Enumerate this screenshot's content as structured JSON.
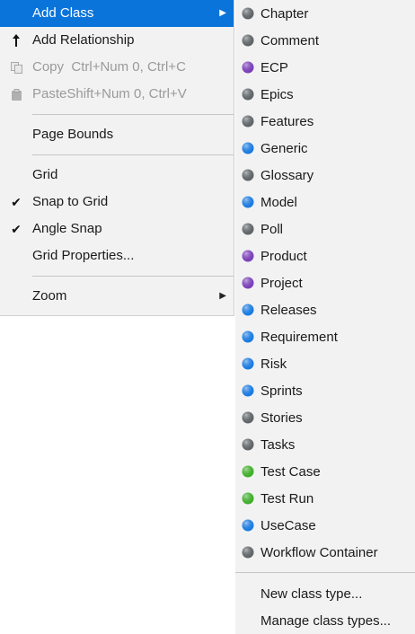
{
  "menu": {
    "items": [
      {
        "label": "Add Class"
      },
      {
        "label": "Add Relationship"
      },
      {
        "label": "Copy",
        "shortcut": "Ctrl+Num 0, Ctrl+C"
      },
      {
        "label": "Paste",
        "shortcut": "Shift+Num 0, Ctrl+V"
      },
      {
        "label": "Page Bounds"
      },
      {
        "label": "Grid"
      },
      {
        "label": "Snap to Grid",
        "checked": true
      },
      {
        "label": "Angle Snap",
        "checked": true
      },
      {
        "label": "Grid Properties..."
      },
      {
        "label": "Zoom"
      }
    ]
  },
  "class_types": [
    {
      "label": "Chapter",
      "color": "#5f6467"
    },
    {
      "label": "Comment",
      "color": "#5f6467"
    },
    {
      "label": "ECP",
      "color": "#7a3fb8"
    },
    {
      "label": "Epics",
      "color": "#5f6467"
    },
    {
      "label": "Features",
      "color": "#5f6467"
    },
    {
      "label": "Generic",
      "color": "#1a7ae0"
    },
    {
      "label": "Glossary",
      "color": "#5f6467"
    },
    {
      "label": "Model",
      "color": "#1a7ae0"
    },
    {
      "label": "Poll",
      "color": "#5f6467"
    },
    {
      "label": "Product",
      "color": "#7a3fb8"
    },
    {
      "label": "Project",
      "color": "#7a3fb8"
    },
    {
      "label": "Releases",
      "color": "#1a7ae0"
    },
    {
      "label": "Requirement",
      "color": "#1a7ae0"
    },
    {
      "label": "Risk",
      "color": "#1a7ae0"
    },
    {
      "label": "Sprints",
      "color": "#1a7ae0"
    },
    {
      "label": "Stories",
      "color": "#5f6467"
    },
    {
      "label": "Tasks",
      "color": "#5f6467"
    },
    {
      "label": "Test Case",
      "color": "#3fae2a"
    },
    {
      "label": "Test Run",
      "color": "#3fae2a"
    },
    {
      "label": "UseCase",
      "color": "#1a7ae0"
    },
    {
      "label": "Workflow Container",
      "color": "#5f6467"
    }
  ],
  "submenu_actions": {
    "new_class_type": "New class type...",
    "manage_class_types": "Manage class types..."
  },
  "colors": {
    "highlight": "#0a74da",
    "menu_bg": "#f2f2f2",
    "disabled_text": "#9a9a9a"
  }
}
